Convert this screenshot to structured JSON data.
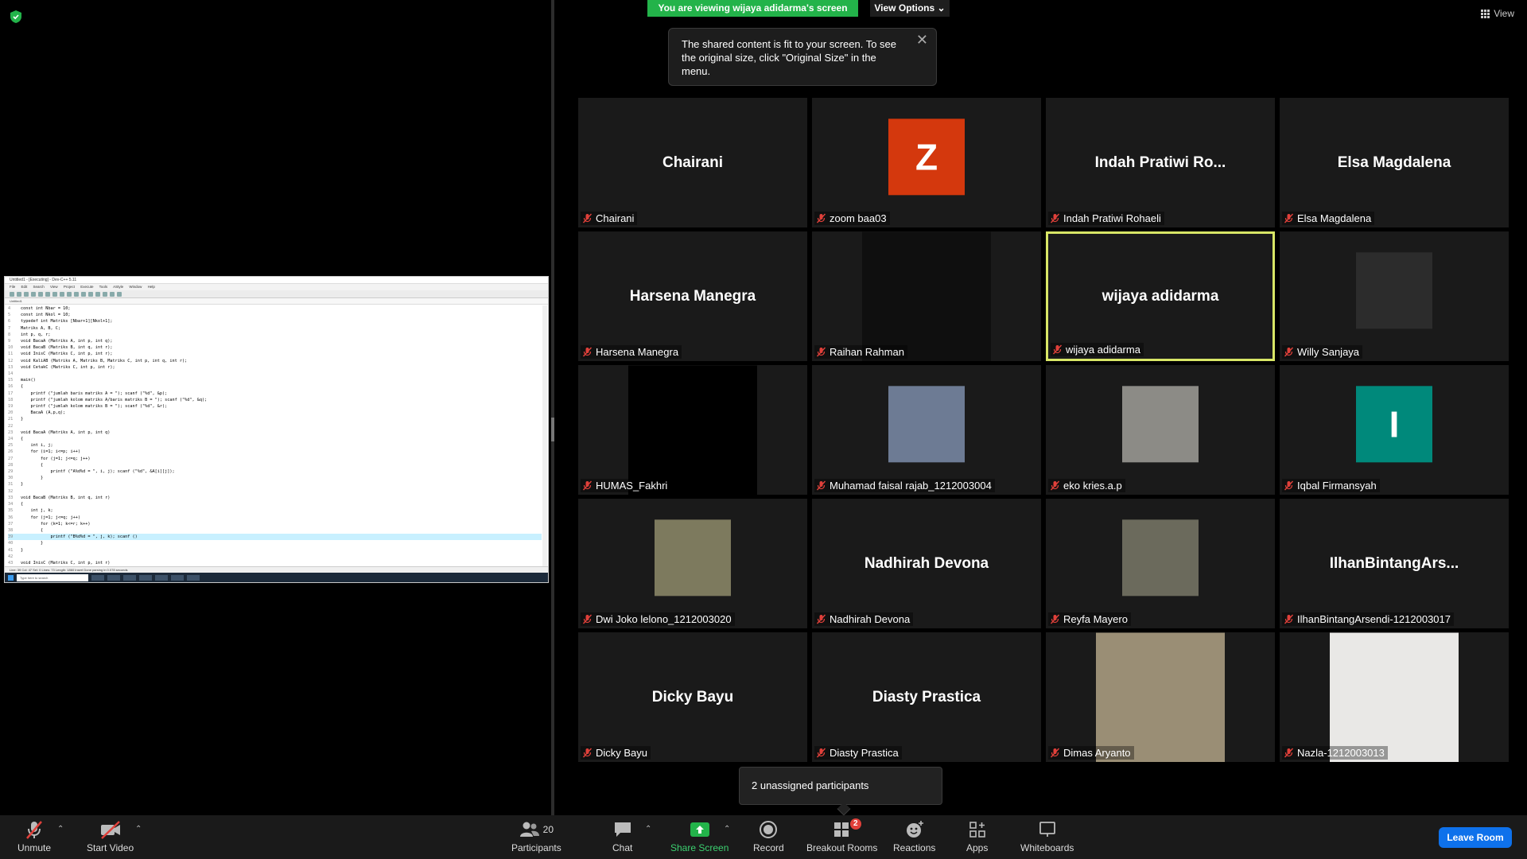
{
  "banner": {
    "viewing": "You are viewing wijaya adidarma's screen",
    "view_options": "View Options",
    "view": "View"
  },
  "tooltip": {
    "text": "The shared content is fit to your screen. To see the original size, click \"Original Size\" in the menu."
  },
  "shared_screen": {
    "window_title": "Untitled1 - [Executing] - Dev-C++ 5.11",
    "menu": "File Edit Search View Project Execute Tools AStyle Window Help",
    "tab": "Untitled1",
    "status": "Line: 39   Col: 47   Sel: 0   Lines: 73   Length: 1860   Insert   Done parsing in 0.078 seconds",
    "taskbar_search": "Type here to search",
    "code_lines": [
      {
        "n": "4",
        "t": "const int Nbar = 10;"
      },
      {
        "n": "5",
        "t": "const int Nkol = 10;"
      },
      {
        "n": "6",
        "t": "typedef int Matriks [Nbar+1][Nkol+1];"
      },
      {
        "n": "7",
        "t": "Matriks A, B, C;"
      },
      {
        "n": "8",
        "t": "int p, q, r;"
      },
      {
        "n": "9",
        "t": "void BacaA (Matriks A, int p, int q);"
      },
      {
        "n": "10",
        "t": "void BacaB (Matriks B, int q, int r);"
      },
      {
        "n": "11",
        "t": "void InisC (Matriks C, int p, int r);"
      },
      {
        "n": "12",
        "t": "void KaliAB (Matriks A, Matriks B, Matriks C, int p, int q, int r);"
      },
      {
        "n": "13",
        "t": "void CetakC (Matriks C, int p, int r);"
      },
      {
        "n": "14",
        "t": ""
      },
      {
        "n": "15",
        "t": "main()"
      },
      {
        "n": "16",
        "t": "{"
      },
      {
        "n": "17",
        "t": "    printf (\"jumlah baris matriks A = \"); scanf (\"%d\", &p);"
      },
      {
        "n": "18",
        "t": "    printf (\"jumlah kolom matriks A/baris matriks B = \"); scanf (\"%d\", &q);"
      },
      {
        "n": "19",
        "t": "    printf (\"jumlah kolom matriks B = \"); scanf (\"%d\", &r);"
      },
      {
        "n": "20",
        "t": "    BacaA (A,p,q);"
      },
      {
        "n": "21",
        "t": "}"
      },
      {
        "n": "22",
        "t": ""
      },
      {
        "n": "23",
        "t": "void BacaA (Matriks A, int p, int q)"
      },
      {
        "n": "24",
        "t": "{"
      },
      {
        "n": "25",
        "t": "    int i, j;"
      },
      {
        "n": "26",
        "t": "    for (i=1; i<=p; i++)"
      },
      {
        "n": "27",
        "t": "        for (j=1; j<=q; j++)"
      },
      {
        "n": "28",
        "t": "        {"
      },
      {
        "n": "29",
        "t": "            printf (\"A%d%d = \", i, j); scanf (\"%d\", &A[i][j]);"
      },
      {
        "n": "30",
        "t": "        }"
      },
      {
        "n": "31",
        "t": "}"
      },
      {
        "n": "32",
        "t": ""
      },
      {
        "n": "33",
        "t": "void BacaB (Matriks B, int q, int r)"
      },
      {
        "n": "34",
        "t": "{"
      },
      {
        "n": "35",
        "t": "    int j, k;"
      },
      {
        "n": "36",
        "t": "    for (j=1; j<=q; j++)"
      },
      {
        "n": "37",
        "t": "        for (k=1; k<=r; k++)"
      },
      {
        "n": "38",
        "t": "        {"
      },
      {
        "n": "39",
        "t": "            printf (\"B%d%d = \", j, k); scanf ()"
      },
      {
        "n": "40",
        "t": "        }"
      },
      {
        "n": "41",
        "t": "}"
      },
      {
        "n": "42",
        "t": ""
      },
      {
        "n": "43",
        "t": "void InisC (Matriks C, int p, int r)"
      }
    ]
  },
  "participants": [
    {
      "display": "Chairani",
      "label": "Chairani",
      "type": "name"
    },
    {
      "display": "Z",
      "label": "zoom baa03",
      "type": "letter",
      "color": "#d4380d"
    },
    {
      "display": "Indah Pratiwi Ro...",
      "label": "Indah Pratiwi Rohaeli",
      "type": "name"
    },
    {
      "display": "Elsa Magdalena",
      "label": "Elsa Magdalena",
      "type": "name"
    },
    {
      "display": "Harsena Manegra",
      "label": "Harsena Manegra",
      "type": "name"
    },
    {
      "display": "",
      "label": "Raihan Rahman",
      "type": "dark"
    },
    {
      "display": "wijaya adidarma",
      "label": "wijaya adidarma",
      "type": "name",
      "active": true
    },
    {
      "display": "",
      "label": "Willy Sanjaya",
      "type": "photo",
      "color": "#2c2c2c"
    },
    {
      "display": "",
      "label": "HUMAS_Fakhri",
      "type": "black"
    },
    {
      "display": "",
      "label": "Muhamad faisal rajab_1212003004",
      "type": "photo",
      "color": "#6d7b94"
    },
    {
      "display": "",
      "label": "eko kries.a.p",
      "type": "photo",
      "color": "#8c8b86"
    },
    {
      "display": "I",
      "label": "Iqbal Firmansyah",
      "type": "letter",
      "color": "#00897b"
    },
    {
      "display": "",
      "label": "Dwi Joko lelono_1212003020",
      "type": "photo",
      "color": "#7d7a5e"
    },
    {
      "display": "Nadhirah Devona",
      "label": "Nadhirah Devona",
      "type": "name"
    },
    {
      "display": "",
      "label": "Reyfa Mayero",
      "type": "photo",
      "color": "#6b6a5c"
    },
    {
      "display": "IlhanBintangArs...",
      "label": "IlhanBintangArsendi-1212003017",
      "type": "name"
    },
    {
      "display": "Dicky Bayu",
      "label": "Dicky Bayu",
      "type": "name"
    },
    {
      "display": "Diasty Prastica",
      "label": "Diasty Prastica",
      "type": "name"
    },
    {
      "display": "",
      "label": "Dimas Aryanto",
      "type": "bigphoto",
      "color": "#9a8e75"
    },
    {
      "display": "",
      "label": "Nazla-1212003013",
      "type": "bigphoto",
      "color": "#e9e8e6"
    }
  ],
  "popup": {
    "text": "2 unassigned participants"
  },
  "toolbar": {
    "unmute": "Unmute",
    "start_video": "Start Video",
    "participants": "Participants",
    "participants_count": "20",
    "chat": "Chat",
    "share_screen": "Share Screen",
    "record": "Record",
    "breakout_rooms": "Breakout Rooms",
    "breakout_badge": "2",
    "reactions": "Reactions",
    "apps": "Apps",
    "whiteboards": "Whiteboards",
    "leave_room": "Leave Room"
  },
  "colors": {
    "accent_green": "#23b34a",
    "active_border": "#d8e666",
    "leave_blue": "#0e71eb",
    "muted_red": "#e0403a"
  }
}
